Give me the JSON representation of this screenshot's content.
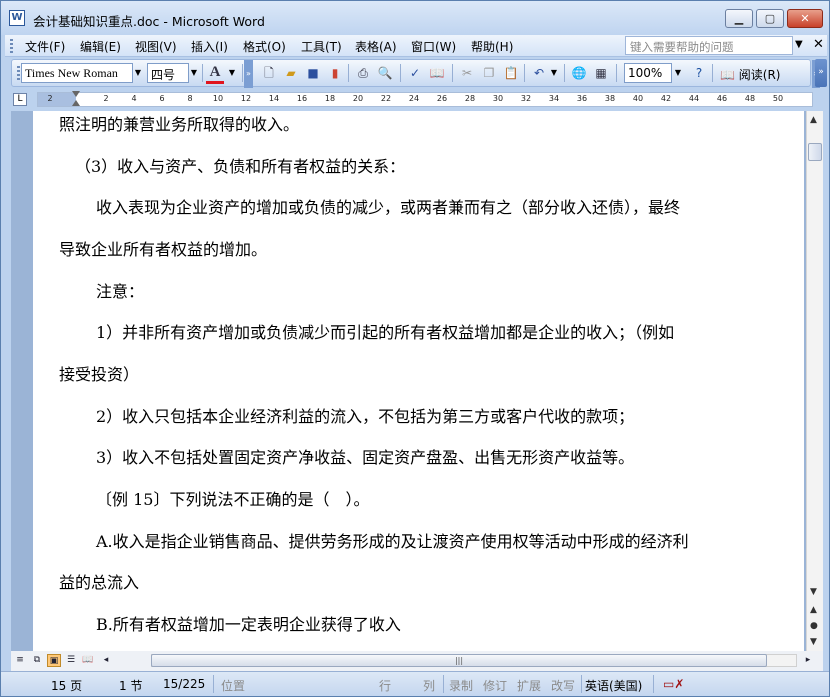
{
  "window": {
    "title": "会计基础知识重点.doc - Microsoft Word",
    "app_icon": "W"
  },
  "menubar": {
    "items": [
      "文件(F)",
      "编辑(E)",
      "视图(V)",
      "插入(I)",
      "格式(O)",
      "工具(T)",
      "表格(A)",
      "窗口(W)",
      "帮助(H)"
    ],
    "help_placeholder": "键入需要帮助的问题"
  },
  "toolbar": {
    "font": "Times New Roman",
    "font_size": "四号",
    "font_color_letter": "A",
    "zoom": "100%",
    "read_label": "阅读(R)",
    "font_color": "#e0141e"
  },
  "ruler": {
    "ticks": [
      "2",
      "2",
      "4",
      "6",
      "8",
      "10",
      "12",
      "14",
      "16",
      "18",
      "20",
      "22",
      "24",
      "26",
      "28",
      "30",
      "32",
      "34",
      "36",
      "38",
      "40",
      "42",
      "44",
      "46",
      "48",
      "50"
    ]
  },
  "document": {
    "paragraphs": [
      "照注明的兼营业务所取得的收入。",
      "（3）收入与资产、负债和所有者权益的关系：",
      "收入表现为企业资产的增加或负债的减少，或两者兼而有之（部分收入还债），最终",
      "导致企业所有者权益的增加。",
      "注意：",
      "1）并非所有资产增加或负债减少而引起的所有者权益增加都是企业的收入；（例如",
      "接受投资）",
      "2）收入只包括本企业经济利益的流入，不包括为第三方或客户代收的款项；",
      "3）收入不包括处置固定资产净收益、固定资产盘盈、出售无形资产收益等。",
      "〔例 15〕下列说法不正确的是（　）。",
      "A.收入是指企业销售商品、提供劳务形成的及让渡资产使用权等活动中形成的经济利",
      "益的总流入",
      "B.所有者权益增加一定表明企业获得了收入"
    ]
  },
  "statusbar": {
    "page": "15 页",
    "section": "1 节",
    "page_of": "15/225",
    "position": "位置",
    "line": "行",
    "column": "列",
    "rec": "录制",
    "trk": "修订",
    "ext": "扩展",
    "ovr": "改写",
    "language": "英语(美国)"
  }
}
